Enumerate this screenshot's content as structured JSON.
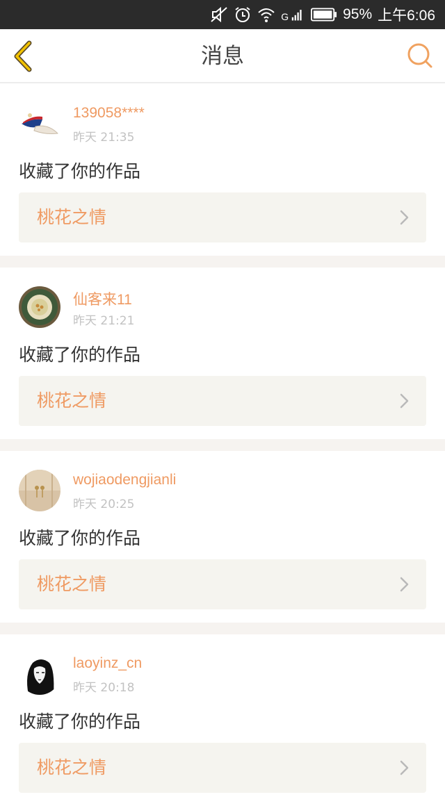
{
  "status_bar": {
    "battery": "95%",
    "time": "上午6:06",
    "network": "G"
  },
  "nav": {
    "title": "消息"
  },
  "messages": [
    {
      "user": "139058****",
      "time": "昨天 21:35",
      "action": "收藏了你的作品",
      "work": "桃花之情"
    },
    {
      "user": "仙客来11",
      "time": "昨天 21:21",
      "action": "收藏了你的作品",
      "work": "桃花之情"
    },
    {
      "user": "wojiaodengjianli",
      "time": "昨天 20:25",
      "action": "收藏了你的作品",
      "work": "桃花之情"
    },
    {
      "user": "laoyinz_cn",
      "time": "昨天 20:18",
      "action": "收藏了你的作品",
      "work": "桃花之情"
    }
  ],
  "colors": {
    "accent": "#ef9a62",
    "back_arrow": "#e8b400",
    "status_bar_bg": "#2b2b2b",
    "work_bg": "#f5f4ef"
  }
}
